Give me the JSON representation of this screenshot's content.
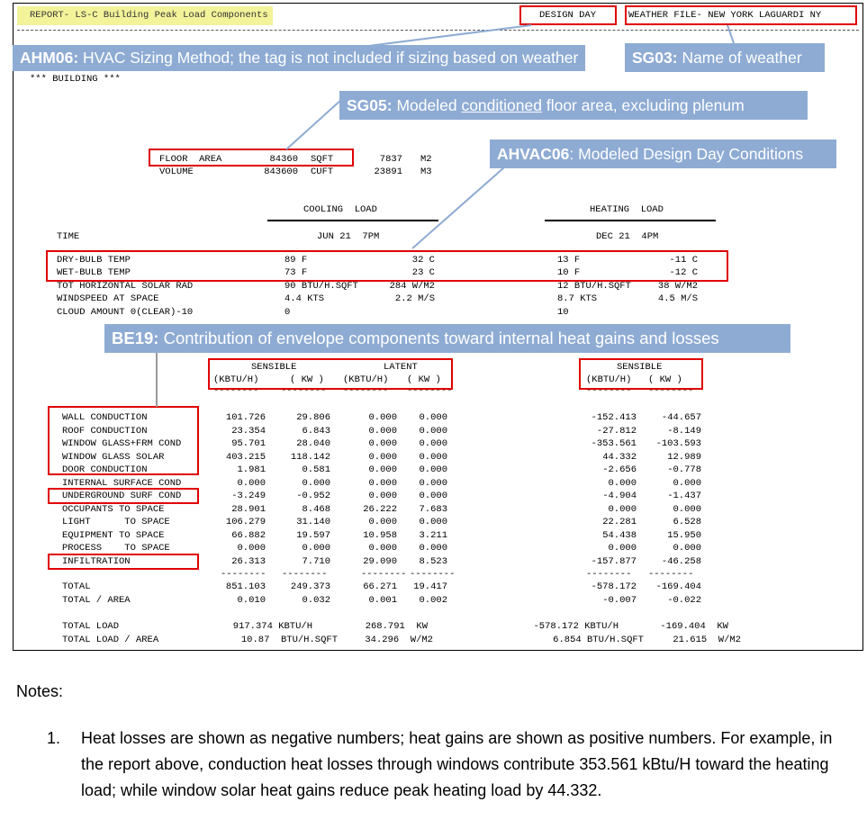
{
  "report": {
    "title": "REPORT- LS-C Building Peak Load Components",
    "design_day": "DESIGN DAY",
    "weather_file": "WEATHER FILE- NEW YORK LAGUARDI NY",
    "building": "*** BUILDING ***",
    "floor_area": {
      "label": "FLOOR  AREA",
      "value": "84360",
      "unit": "SQFT",
      "value_m": "7837",
      "unit_m": "M2"
    },
    "volume": {
      "label": "VOLUME",
      "value": "843600",
      "unit": "CUFT",
      "value_m": "23891",
      "unit_m": "M3"
    },
    "cooling_load_header": "COOLING  LOAD",
    "heating_load_header": "HEATING  LOAD",
    "time_label": "TIME",
    "cooling_time": "JUN 21  7PM",
    "heating_time": "DEC 21  4PM",
    "conditions": [
      {
        "label": "DRY-BULB TEMP",
        "c1": "89 F",
        "c2": "32 C",
        "h1": "13 F",
        "h2": "-11 C"
      },
      {
        "label": "WET-BULB TEMP",
        "c1": "73 F",
        "c2": "23 C",
        "h1": "10 F",
        "h2": "-12 C"
      },
      {
        "label": "TOT HORIZONTAL SOLAR RAD",
        "c1": "90 BTU/H.SQFT",
        "c2": "284 W/M2",
        "h1": "12 BTU/H.SQFT",
        "h2": "38 W/M2"
      },
      {
        "label": "WINDSPEED AT SPACE",
        "c1": "4.4 KTS",
        "c2": "2.2 M/S",
        "h1": "8.7 KTS",
        "h2": "4.5 M/S"
      },
      {
        "label": "CLOUD AMOUNT 0(CLEAR)-10",
        "c1": "0",
        "c2": "",
        "h1": "10",
        "h2": ""
      }
    ],
    "col_headers": {
      "sensible": "SENSIBLE",
      "latent": "LATENT",
      "kbtuh": "(KBTU/H)",
      "kw": "( KW )",
      "heat_sensible": "SENSIBLE",
      "heat_kbtuh": "(KBTU/H)",
      "heat_kw": "( KW )",
      "underline": "--------"
    },
    "components": [
      {
        "label": "WALL CONDUCTION",
        "v": [
          "101.726",
          "29.806",
          "0.000",
          "0.000",
          "-152.413",
          "-44.657"
        ]
      },
      {
        "label": "ROOF CONDUCTION",
        "v": [
          "23.354",
          "6.843",
          "0.000",
          "0.000",
          "-27.812",
          "-8.149"
        ]
      },
      {
        "label": "WINDOW GLASS+FRM COND",
        "v": [
          "95.701",
          "28.040",
          "0.000",
          "0.000",
          "-353.561",
          "-103.593"
        ]
      },
      {
        "label": "WINDOW GLASS SOLAR",
        "v": [
          "403.215",
          "118.142",
          "0.000",
          "0.000",
          "44.332",
          "12.989"
        ]
      },
      {
        "label": "DOOR CONDUCTION",
        "v": [
          "1.981",
          "0.581",
          "0.000",
          "0.000",
          "-2.656",
          "-0.778"
        ]
      },
      {
        "label": "INTERNAL SURFACE COND",
        "v": [
          "0.000",
          "0.000",
          "0.000",
          "0.000",
          "0.000",
          "0.000"
        ]
      },
      {
        "label": "UNDERGROUND SURF COND",
        "v": [
          "-3.249",
          "-0.952",
          "0.000",
          "0.000",
          "-4.904",
          "-1.437"
        ]
      },
      {
        "label": "OCCUPANTS TO SPACE",
        "v": [
          "28.901",
          "8.468",
          "26.222",
          "7.683",
          "0.000",
          "0.000"
        ]
      },
      {
        "label": "LIGHT      TO SPACE",
        "v": [
          "106.279",
          "31.140",
          "0.000",
          "0.000",
          "22.281",
          "6.528"
        ]
      },
      {
        "label": "EQUIPMENT TO SPACE",
        "v": [
          "66.882",
          "19.597",
          "10.958",
          "3.211",
          "54.438",
          "15.950"
        ]
      },
      {
        "label": "PROCESS    TO SPACE",
        "v": [
          "0.000",
          "0.000",
          "0.000",
          "0.000",
          "0.000",
          "0.000"
        ]
      },
      {
        "label": "INFILTRATION",
        "v": [
          "26.313",
          "7.710",
          "29.090",
          "8.523",
          "-157.877",
          "-46.258"
        ]
      }
    ],
    "totals": [
      {
        "label": "TOTAL",
        "v": [
          "851.103",
          "249.373",
          "66.271",
          "19.417",
          "-578.172",
          "-169.404"
        ]
      },
      {
        "label": "TOTAL / AREA",
        "v": [
          "0.010",
          "0.032",
          "0.001",
          "0.002",
          "-0.007",
          "-0.022"
        ]
      }
    ],
    "total_load": {
      "label": "TOTAL LOAD",
      "c1": "917.374 KBTU/H",
      "c2": "268.791  KW",
      "h1": "-578.172 KBTU/H",
      "h2": "-169.404  KW"
    },
    "total_load_area": {
      "label": "TOTAL LOAD / AREA",
      "c1": "10.87  BTU/H.SQFT",
      "c2": "34.296  W/M2",
      "h1": "6.854 BTU/H.SQFT",
      "h2": "21.615  W/M2"
    }
  },
  "callouts": {
    "ahm06": {
      "code": "AHM06:",
      "text": " HVAC Sizing Method; the tag is not included if sizing based on weather"
    },
    "sg03": {
      "code": "SG03:",
      "text": " Name of weather"
    },
    "sg05": {
      "code": "SG05:",
      "text_before": " Modeled ",
      "underlined": "conditioned",
      "text_after": " floor area, excluding plenum"
    },
    "ahvac06": {
      "code": "AHVAC06",
      "text": ": Modeled Design Day Conditions"
    },
    "be19": {
      "code": "BE19:",
      "text": " Contribution of envelope components toward internal heat gains and losses"
    }
  },
  "notes": {
    "heading": "Notes:",
    "items": [
      {
        "num": "1.",
        "text": "Heat losses are shown as negative numbers; heat gains are shown as positive numbers. For example, in the report above, conduction heat losses through windows contribute 353.561 kBtu/H toward the heating load; while window solar heat gains reduce peak heating load by 44.332."
      }
    ]
  }
}
